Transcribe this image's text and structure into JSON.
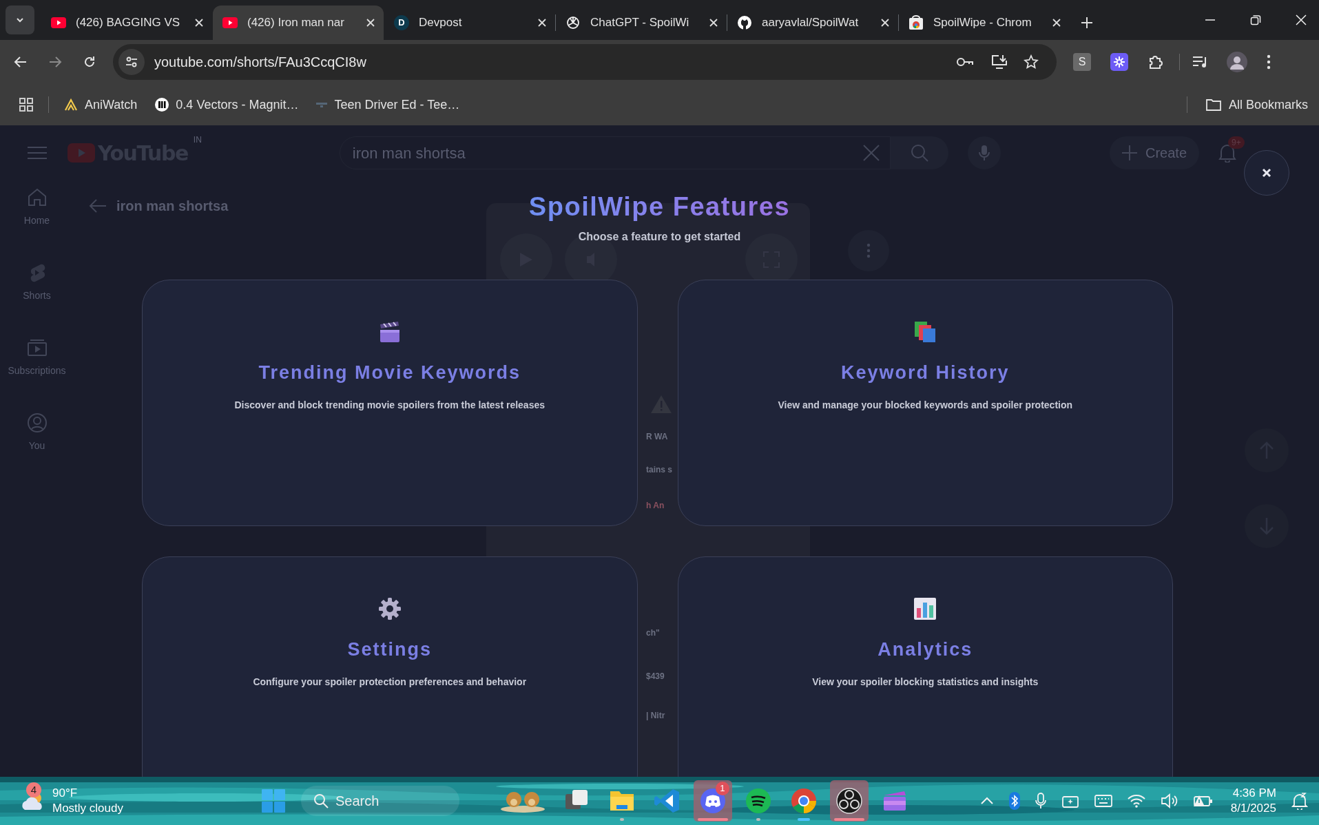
{
  "browser": {
    "tabs": [
      {
        "title": "(426) BAGGING VS",
        "selected": false
      },
      {
        "title": "(426) Iron man nar",
        "selected": true
      },
      {
        "icon_text": "D",
        "title": "Devpost",
        "selected": false
      },
      {
        "title": "ChatGPT - SpoilWi",
        "selected": false
      },
      {
        "title": "aaryavlal/SpoilWat",
        "selected": false
      },
      {
        "title": "SpoilWipe - Chrom",
        "selected": false
      }
    ],
    "forward_enabled": false,
    "address": "youtube.com/shorts/FAu3CcqCI8w",
    "extensions": [
      {
        "kind": "letter",
        "text": "S"
      },
      {
        "kind": "snowflake"
      },
      {
        "kind": "puzzle"
      }
    ],
    "bookmarks": [
      {
        "label": "AniWatch"
      },
      {
        "label": "0.4 Vectors - Magnit…"
      },
      {
        "label": "Teen Driver Ed - Tee…"
      }
    ],
    "all_bookmarks": "All Bookmarks"
  },
  "youtube": {
    "logo": "YouTube",
    "region": "IN",
    "search": "iron man shortsa",
    "create": "Create",
    "notifications": "9+",
    "nav": [
      {
        "label": "Home"
      },
      {
        "label": "Shorts"
      },
      {
        "label": "Subscriptions"
      },
      {
        "label": "You"
      }
    ],
    "query_title": "iron man shortsa",
    "fragments": [
      {
        "text": "R WA"
      },
      {
        "text": "tains s"
      },
      {
        "text": "h An"
      },
      {
        "text": "ch\""
      },
      {
        "text": "$439"
      },
      {
        "text": "| Nitr"
      }
    ]
  },
  "modal": {
    "title": "SpoilWipe Features",
    "subtitle": "Choose a feature to get started",
    "features": [
      {
        "title": "Trending Movie Keywords",
        "description": "Discover and block trending movie spoilers from the latest releases"
      },
      {
        "title": "Keyword History",
        "description": "View and manage your blocked keywords and spoiler protection"
      },
      {
        "title": "Settings",
        "description": "Configure your spoiler protection preferences and behavior"
      },
      {
        "title": "Analytics",
        "description": "View your spoiler blocking statistics and insights"
      }
    ]
  },
  "taskbar": {
    "weather": {
      "badge": "4",
      "temperature": "90°F",
      "condition": "Mostly cloudy"
    },
    "search": "Search",
    "apps": [
      {
        "kind": "widget",
        "open": false,
        "selected": false,
        "flashing": false
      },
      {
        "kind": "taskview",
        "open": false,
        "selected": false,
        "flashing": false
      },
      {
        "kind": "explorer",
        "open": true,
        "selected": false,
        "flashing": false
      },
      {
        "kind": "vscode",
        "open": false,
        "selected": false,
        "flashing": false
      },
      {
        "kind": "discord",
        "open": true,
        "selected": false,
        "flashing": true,
        "badge": "1"
      },
      {
        "kind": "spotify",
        "open": true,
        "selected": false,
        "flashing": false
      },
      {
        "kind": "chrome",
        "open": true,
        "selected": true,
        "flashing": false
      },
      {
        "kind": "obs",
        "open": true,
        "selected": false,
        "flashing": true
      },
      {
        "kind": "clipchamp",
        "open": false,
        "selected": false,
        "flashing": false
      }
    ],
    "time": "4:36 PM",
    "date": "8/1/2025"
  }
}
